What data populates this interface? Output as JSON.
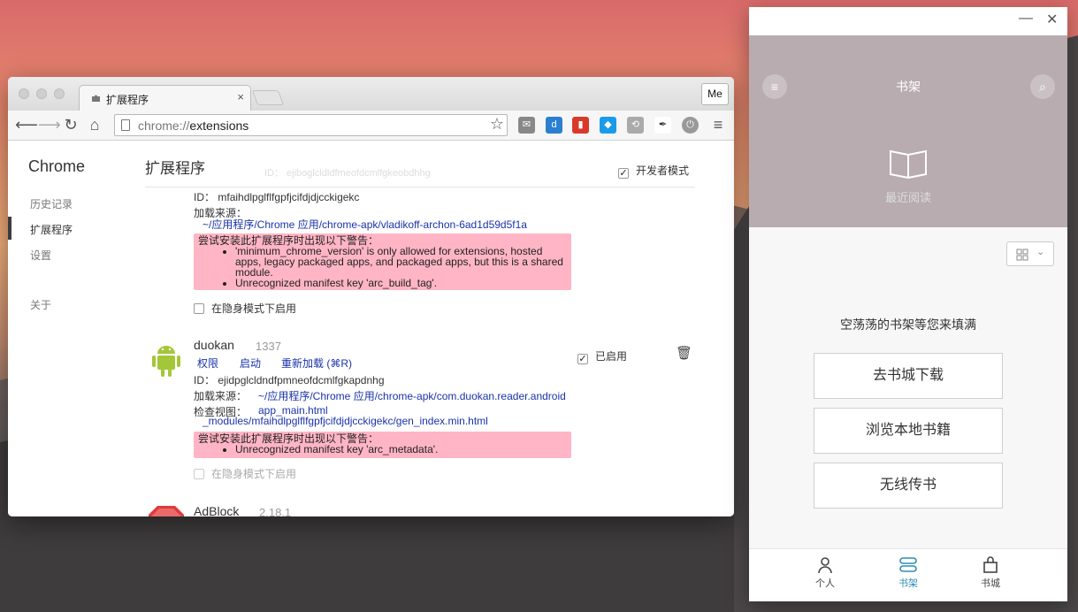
{
  "chrome": {
    "tab_title": "扩展程序",
    "tab_close": "×",
    "profile_label": "Me",
    "url_scheme": "chrome://",
    "url_path": "extensions",
    "colors": {
      "accent_link": "#1a33aa",
      "warning_bg": "#ffb5c5"
    }
  },
  "sidebar": {
    "title": "Chrome",
    "items": [
      {
        "label": "历史记录"
      },
      {
        "label": "扩展程序"
      },
      {
        "label": "设置"
      },
      {
        "label": "关于"
      }
    ]
  },
  "page": {
    "heading": "扩展程序",
    "ghost_id": "ID： ejiboglcldldfmeofdcmlfgkeobdhhg",
    "dev_mode_label": "开发者模式",
    "dev_mode_checked": true
  },
  "ext1": {
    "id_label": "ID：",
    "id_value": "mfaihdlpglflfgpfjcifdjdjcckigekc",
    "source_label": "加载来源：",
    "source_path": "~/应用程序/Chrome 应用/chrome-apk/vladikoff-archon-6ad1d59d5f1a",
    "warn_title": "尝试安装此扩展程序时出现以下警告：",
    "warn_1": "'minimum_chrome_version' is only allowed for extensions, hosted apps, legacy packaged apps, and packaged apps, but this is a shared module.",
    "warn_2": "Unrecognized manifest key 'arc_build_tag'.",
    "incognito_label": "在隐身模式下启用"
  },
  "ext2": {
    "name": "duokan",
    "version": "1337",
    "link_permissions": "权限",
    "link_launch": "启动",
    "link_reload": "重新加载 (⌘R)",
    "enabled_label": "已启用",
    "id_label": "ID：",
    "id_value": "ejidpglcldndfpmneofdcmlfgkapdnhg",
    "source_label": "加载来源：",
    "source_path": "~/应用程序/Chrome 应用/chrome-apk/com.duokan.reader.android",
    "inspect_label": "检查视图：",
    "inspect_view_1": "app_main.html",
    "inspect_view_2": "_modules/mfaihdlpglflfgpfjcifdjdjcckigekc/gen_index.min.html",
    "warn_title": "尝试安装此扩展程序时出现以下警告：",
    "warn_1": "Unrecognized manifest key 'arc_metadata'.",
    "incognito_label": "在隐身模式下启用"
  },
  "ext3": {
    "name": "AdBlock",
    "version": "2.18.1"
  },
  "reader": {
    "header_title": "书架",
    "recent_label": "最近阅读",
    "empty_text": "空荡荡的书架等您来填满",
    "btn_store": "去书城下载",
    "btn_local": "浏览本地书籍",
    "btn_wireless": "无线传书",
    "tabs": [
      {
        "label": "个人"
      },
      {
        "label": "书架"
      },
      {
        "label": "书城"
      }
    ],
    "colors": {
      "header_bg": "#b8acb0",
      "active_tab": "#2d8fb3"
    }
  }
}
